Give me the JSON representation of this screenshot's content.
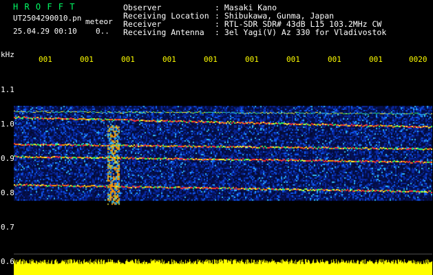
{
  "app": {
    "name": "H R O F F T",
    "filename": "UT2504290010.pn",
    "mode_label": "meteor",
    "datetime": "25.04.29 00:10",
    "count": "0..",
    "name_color": "#00ff66",
    "filename_color": "#00ffff",
    "date_color": "#ffffff"
  },
  "info": {
    "labels": [
      "Observer",
      "Receiving Location",
      "Receiver",
      "Receiving Antenna"
    ],
    "values": [
      ": Masaki Kano",
      ": Shibukawa, Gunma, Japan",
      ": RTL-SDR SDR# 43dB L15 103.2MHz CW",
      ": 3el Yagi(V) Az 330 for Vladivostok"
    ]
  },
  "axis": {
    "unit": "kHz",
    "y_ticks": [
      "1.1",
      "1.0",
      "0.9",
      "0.8",
      "0.7",
      "0.6"
    ],
    "time_ticks": [
      "001",
      "001",
      "001",
      "001",
      "001",
      "001",
      "001",
      "001",
      "001",
      "0020"
    ],
    "tick_color": "#ffff00"
  },
  "colors": {
    "background": "#000000",
    "noise_base": "#0a0a70",
    "signal": "#ff2020",
    "fill_bar": "#ffff00"
  }
}
